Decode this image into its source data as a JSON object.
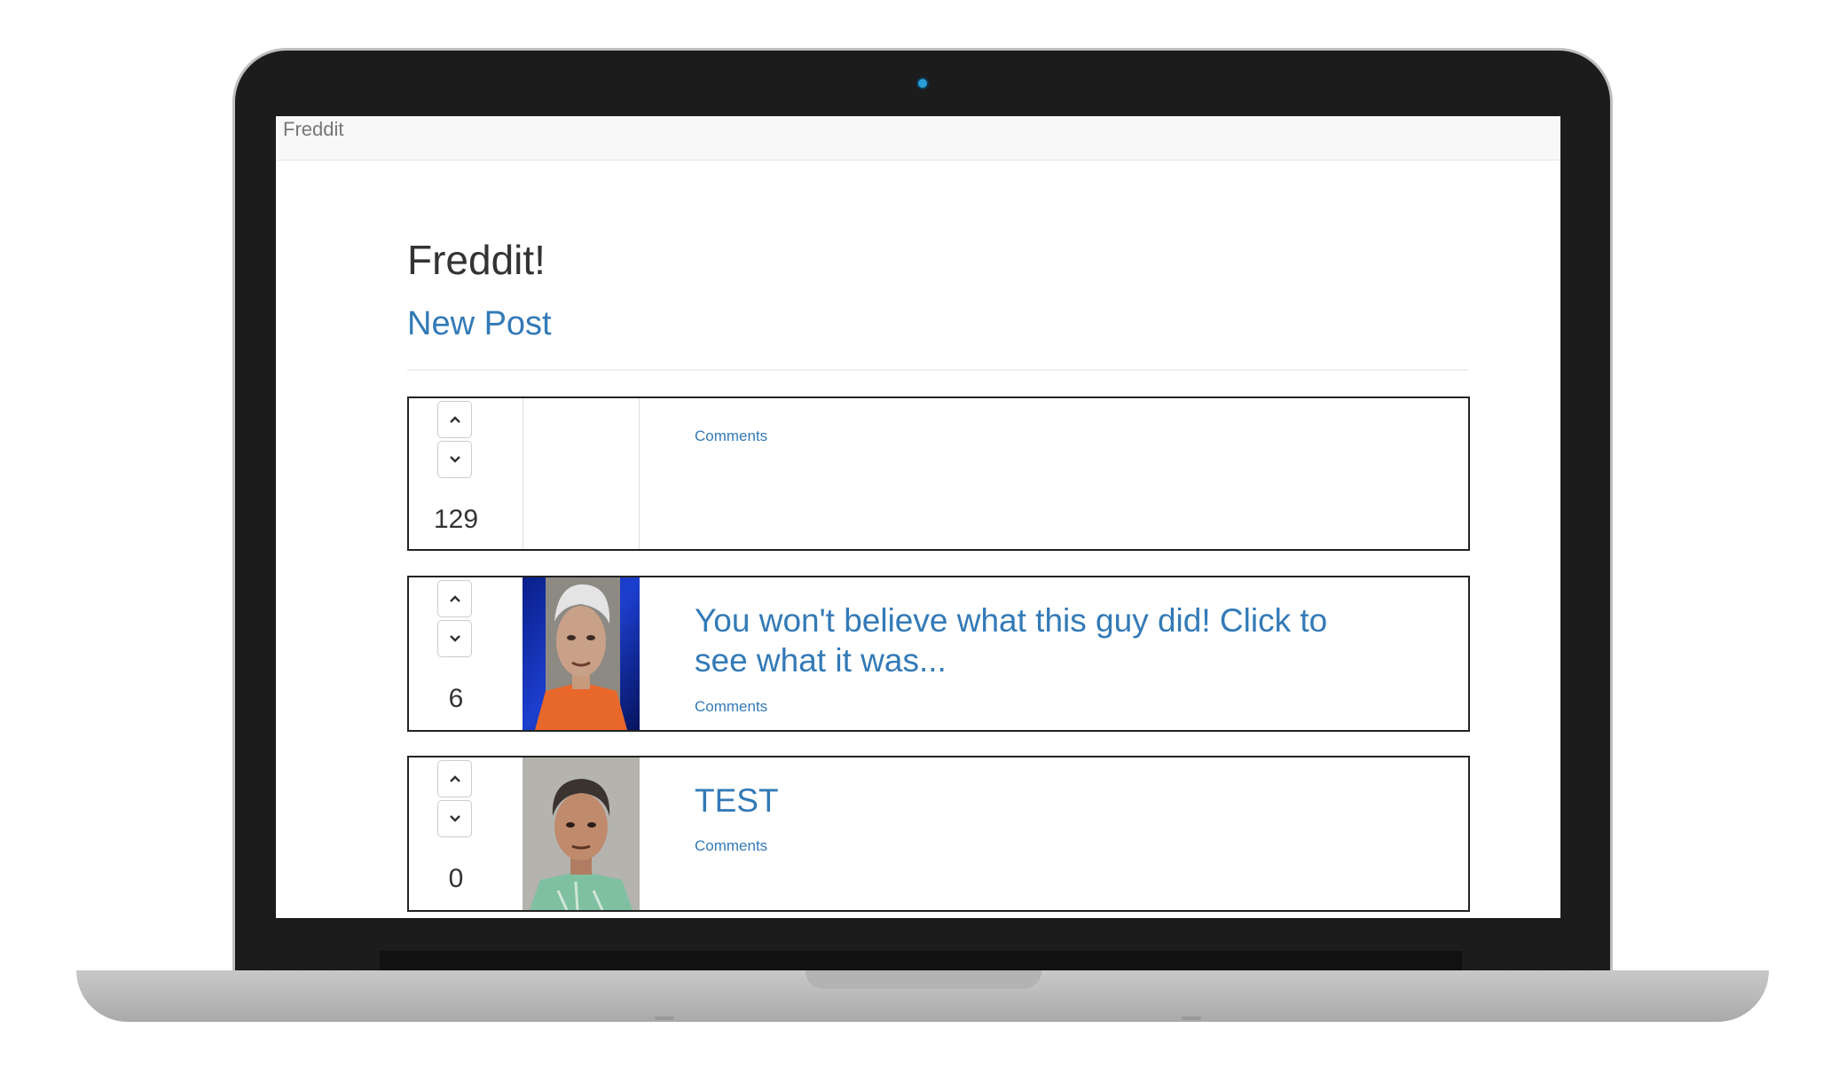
{
  "navbar": {
    "brand": "Freddit"
  },
  "header": {
    "title": "Freddit!",
    "new_post_label": "New Post"
  },
  "posts": [
    {
      "score": "129",
      "title": "",
      "comments_label": "Comments",
      "thumbnail": "none"
    },
    {
      "score": "6",
      "title": "You won't believe what this guy did! Click to see what it was...",
      "comments_label": "Comments",
      "thumbnail": "photo-man-orange-jumpsuit-hairnet"
    },
    {
      "score": "0",
      "title": "TEST",
      "comments_label": "Comments",
      "thumbnail": "photo-man-mugshot-green-shirt"
    }
  ],
  "icons": {
    "upvote": "chevron-up-icon",
    "downvote": "chevron-down-icon"
  },
  "colors": {
    "link": "#337ab7",
    "navbar": "#f8f8f8",
    "laptop_frame": "#1c1c1c",
    "camera": "#2a9fd6"
  }
}
